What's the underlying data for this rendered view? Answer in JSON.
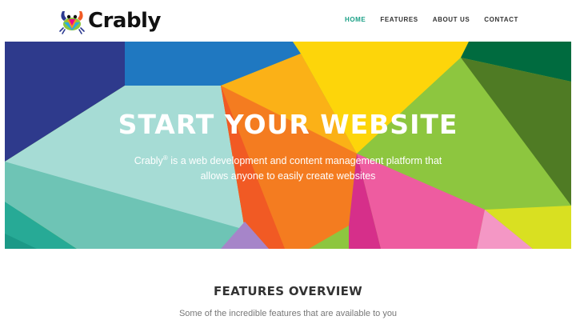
{
  "brand": {
    "logo_text": "Crably"
  },
  "nav": {
    "items": [
      "HOME",
      "FEATURES",
      "ABOUT US",
      "CONTACT"
    ],
    "active": "HOME"
  },
  "hero": {
    "title": "START YOUR WEBSITE",
    "subtitle_brand": "Crably",
    "subtitle_mark": "®",
    "subtitle_rest": " is a web development and content management platform that allows anyone to easily create websites"
  },
  "features": {
    "title": "FEATURES OVERVIEW",
    "subtitle": "Some of the incredible features that are available to you"
  },
  "colors": {
    "accent": "#1aa086",
    "text_dark": "#333333",
    "text_muted": "#777777"
  }
}
